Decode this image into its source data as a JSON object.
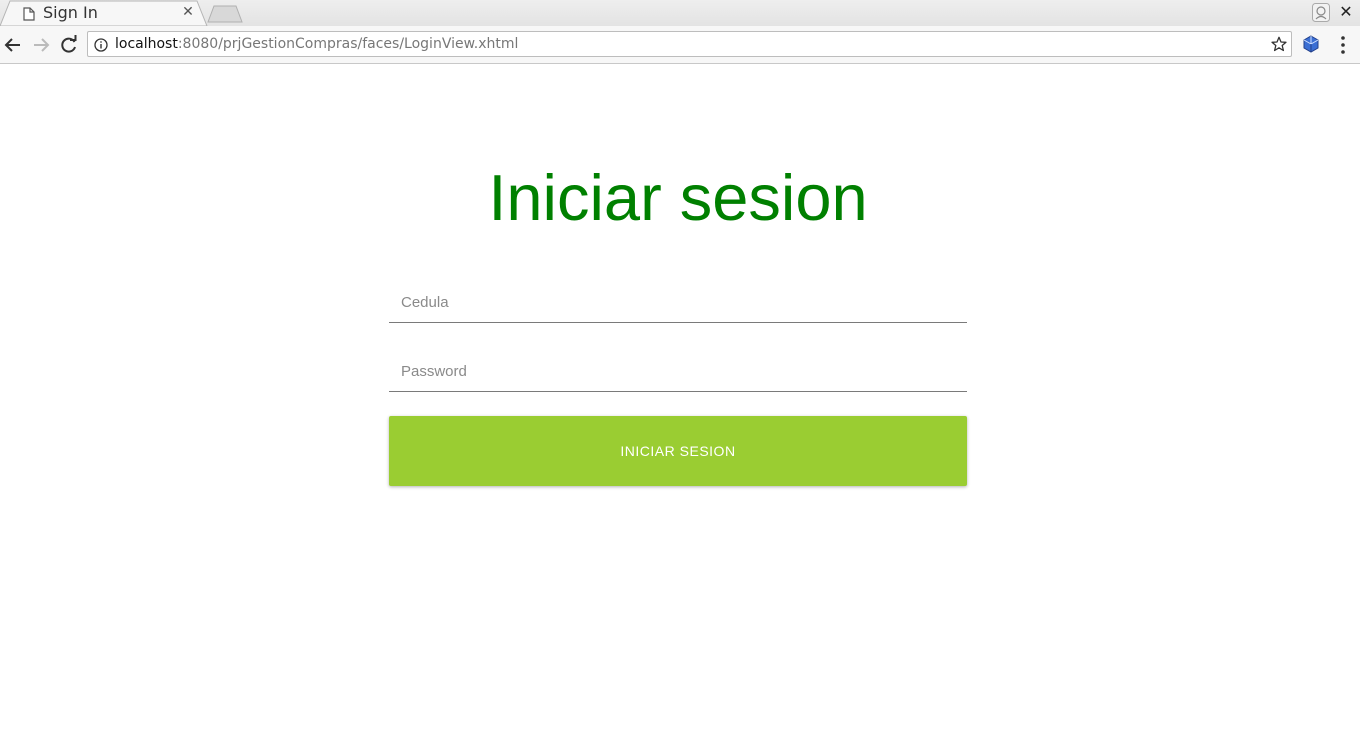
{
  "browser": {
    "tab": {
      "title": "Sign In"
    },
    "address_bar": {
      "host": "localhost",
      "path": ":8080/prjGestionCompras/faces/LoginView.xhtml"
    }
  },
  "page": {
    "title": "Iniciar sesion",
    "cedula": {
      "placeholder": "Cedula",
      "value": ""
    },
    "password": {
      "placeholder": "Password",
      "value": ""
    },
    "submit_label": "INICIAR SESION"
  },
  "colors": {
    "title": "#008000",
    "button_background": "#9acd32",
    "button_text": "#ffffff"
  },
  "icons": [
    "page-icon",
    "close-icon",
    "new-tab-icon",
    "profile-icon",
    "window-close-icon",
    "back-icon",
    "forward-icon",
    "reload-icon",
    "info-icon",
    "star-icon",
    "extension-icon",
    "menu-icon"
  ]
}
